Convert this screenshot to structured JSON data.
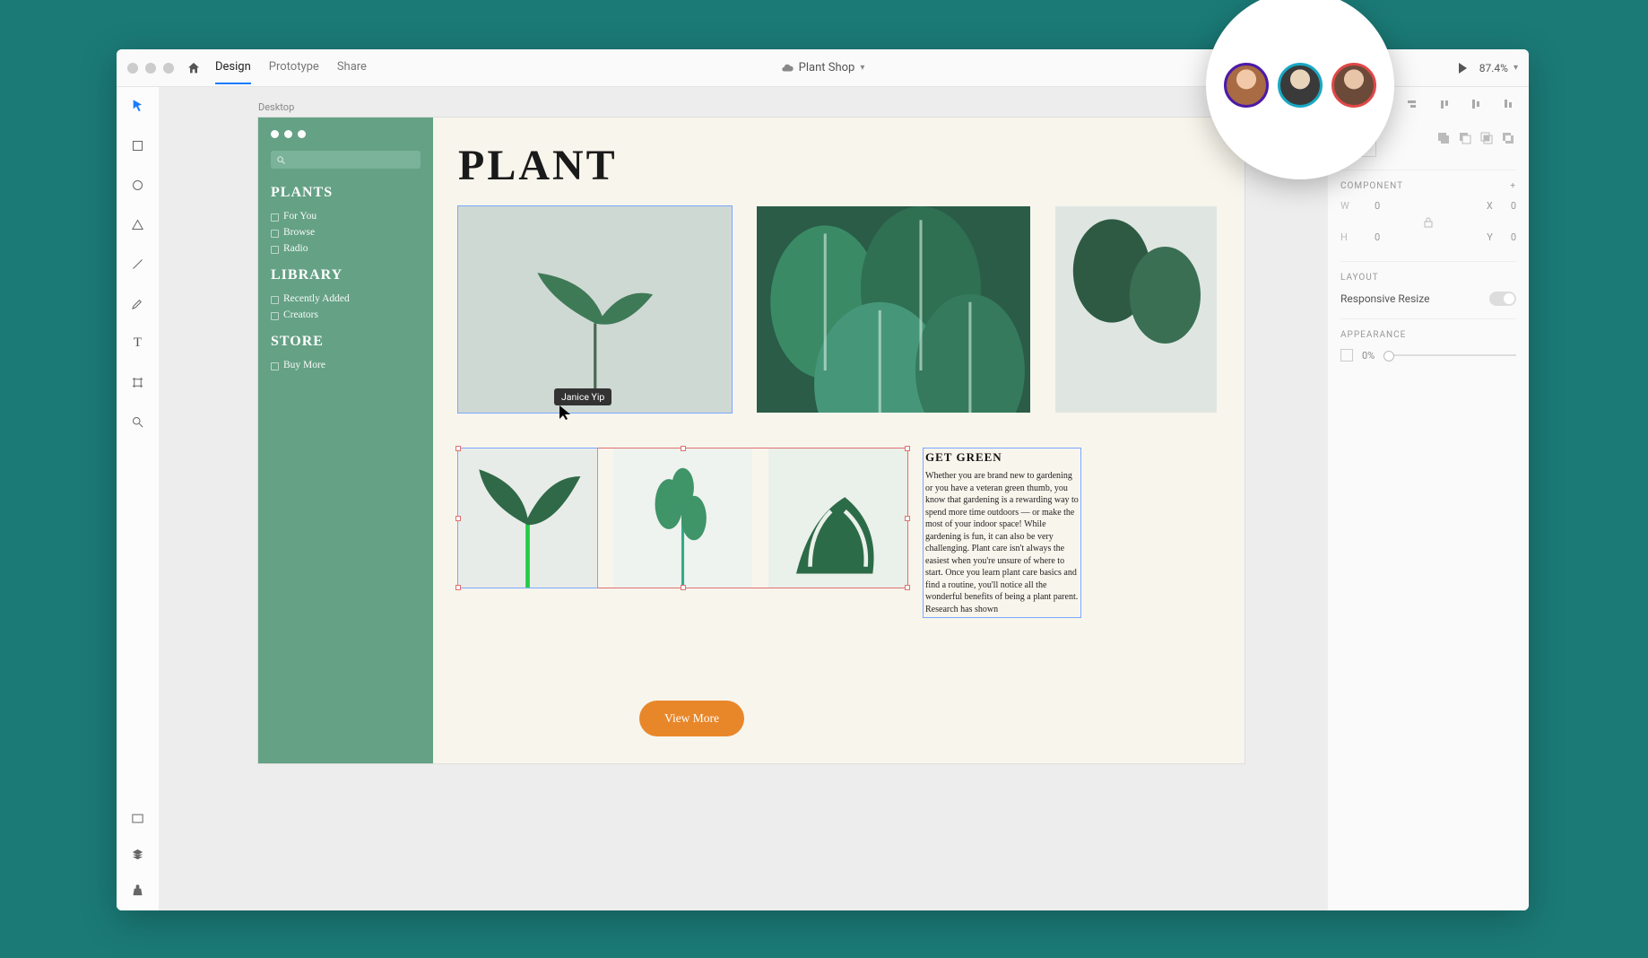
{
  "titlebar": {
    "tabs": {
      "design": "Design",
      "prototype": "Prototype",
      "share": "Share"
    },
    "document_name": "Plant Shop",
    "zoom": "87.4%"
  },
  "collaborators": [
    {
      "ring": "#4b1aa8"
    },
    {
      "ring": "#19a8c4"
    },
    {
      "ring": "#e04848"
    }
  ],
  "canvas": {
    "artboard_label": "Desktop",
    "cursor_user": "Janice Yip"
  },
  "design": {
    "title": "PLANT",
    "sidebar": {
      "sections": [
        {
          "heading": "PLANTS",
          "items": [
            "For You",
            "Browse",
            "Radio"
          ]
        },
        {
          "heading": "LIBRARY",
          "items": [
            "Recently Added",
            "Creators"
          ]
        },
        {
          "heading": "STORE",
          "items": [
            "Buy More"
          ]
        }
      ]
    },
    "article": {
      "heading": "GET GREEN",
      "body": "Whether you are brand new to gardening or you have a veteran green thumb, you know that gardening is a rewarding way to spend more time outdoors — or make the most of your indoor space! While gardening is fun, it can also be very challenging. Plant care isn't always the easiest when you're unsure of where to start. Once you learn plant care basics and find a routine, you'll notice all the wonderful benefits of being a plant parent. Research has shown"
    },
    "cta": "View More"
  },
  "right_panel": {
    "component_label": "COMPONENT",
    "dims": {
      "w_label": "W",
      "w_value": "0",
      "x_label": "X",
      "x_value": "0",
      "h_label": "H",
      "h_value": "0",
      "y_label": "Y",
      "y_value": "0"
    },
    "layout_label": "LAYOUT",
    "responsive_label": "Responsive Resize",
    "appearance_label": "APPEARANCE",
    "opacity_value": "0%"
  }
}
